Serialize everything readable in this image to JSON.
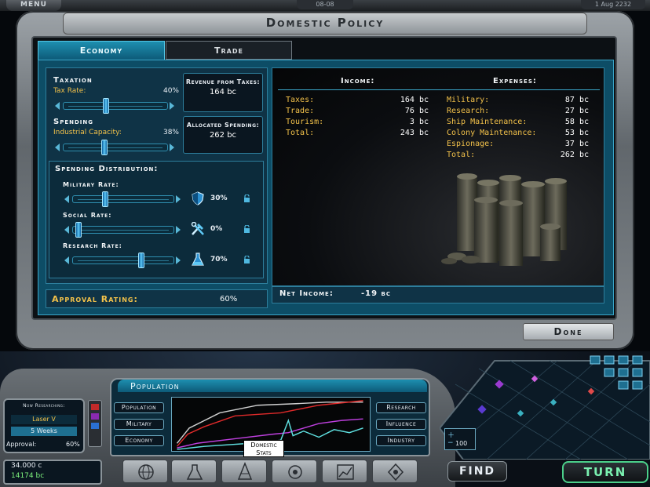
{
  "topbar": {
    "menu_label": "MENU",
    "center_label": "08-08",
    "date": "1 Aug 2232"
  },
  "dialog": {
    "title": "Domestic Policy",
    "tabs": [
      {
        "label": "Economy",
        "active": true
      },
      {
        "label": "Trade",
        "active": false
      }
    ],
    "done_label": "Done"
  },
  "taxation": {
    "header": "Taxation",
    "tax_rate_label": "Tax Rate:",
    "tax_rate_value": "40%",
    "tax_rate_fraction": 0.4,
    "revenue_label": "Revenue from Taxes:",
    "revenue_value": "164 bc"
  },
  "spending": {
    "header": "Spending",
    "industrial_label": "Industrial Capacity:",
    "industrial_value": "38%",
    "industrial_fraction": 0.38,
    "allocated_label": "Allocated Spending:",
    "allocated_value": "262 bc"
  },
  "distribution": {
    "header": "Spending Distribution:",
    "rates": [
      {
        "label": "Military Rate:",
        "value": "30%",
        "fraction": 0.3,
        "icon": "shield-icon"
      },
      {
        "label": "Social Rate:",
        "value": "0%",
        "fraction": 0.0,
        "icon": "tools-icon"
      },
      {
        "label": "Research Rate:",
        "value": "70%",
        "fraction": 0.7,
        "icon": "flask-icon"
      }
    ]
  },
  "approval": {
    "label": "Approval Rating:",
    "value": "60%"
  },
  "income": {
    "header": "Income:",
    "rows": [
      {
        "label": "Taxes:",
        "value": "164 bc"
      },
      {
        "label": "Trade:",
        "value": "76 bc"
      },
      {
        "label": "Tourism:",
        "value": "3 bc"
      },
      {
        "label": "Total:",
        "value": "243 bc"
      }
    ]
  },
  "expenses": {
    "header": "Expenses:",
    "rows": [
      {
        "label": "Military:",
        "value": "87 bc"
      },
      {
        "label": "Research:",
        "value": "27 bc"
      },
      {
        "label": "Ship Maintenance:",
        "value": "58 bc"
      },
      {
        "label": "Colony Maintenance:",
        "value": "53 bc"
      },
      {
        "label": "Espionage:",
        "value": "37 bc"
      },
      {
        "label": "Total:",
        "value": "262 bc"
      }
    ]
  },
  "net_income": {
    "label": "Net Income:",
    "value": "-19 bc"
  },
  "population_panel": {
    "header": "Population",
    "left_buttons": [
      "Population",
      "Military",
      "Economy"
    ],
    "right_buttons": [
      "Research",
      "Influence",
      "Industry"
    ],
    "tooltip_line1": "Domestic",
    "tooltip_line2": "Stats"
  },
  "research": {
    "title": "Now Researching:",
    "tech": "Laser V",
    "eta": "5 Weeks",
    "approval_label": "Approval:",
    "approval_value": "60%"
  },
  "credits": {
    "treasury": "34.000 c",
    "income": "14174 bc"
  },
  "bottom": {
    "find_label": "FIND",
    "turn_label": "TURN",
    "zoom_value": "100"
  },
  "colors": {
    "accent": "#1e8fb0",
    "label_yellow": "#f2c14a",
    "turn_green": "#4bd08a"
  }
}
